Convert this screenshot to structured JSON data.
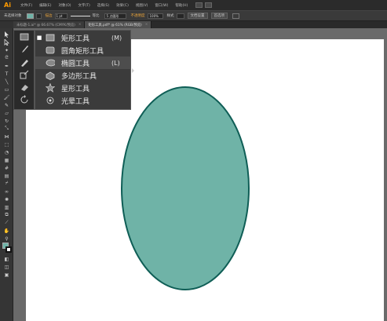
{
  "app": {
    "logo": "Ai",
    "accent": "#ff9a00"
  },
  "menubar": {
    "items": [
      "文件(F)",
      "编辑(E)",
      "对象(O)",
      "文字(T)",
      "选择(S)",
      "效果(C)",
      "视图(V)",
      "窗口(W)",
      "帮助(H)"
    ]
  },
  "controlbar": {
    "selection_label": "未选择对象",
    "fill_color": "#6fb3a7",
    "stroke_label": "描边",
    "stroke_width_value": "1 pt",
    "stroke_profile": "等比",
    "brush_value": "5 点圆形",
    "opacity_label": "不透明度",
    "opacity_value": "100%",
    "style_label": "样式",
    "doc_setup_button": "文档设置",
    "preferences_button": "首选项"
  },
  "tabs": [
    {
      "label": "未标题-1.ai* @ 66.67% (CMYK/预览)",
      "active": false,
      "close": "×"
    },
    {
      "label": "矩形工具.pdf* @ 61% (RGB/预览)",
      "active": true,
      "close": "×"
    }
  ],
  "flyout": {
    "items": [
      {
        "label": "矩形工具",
        "shortcut": "(M)",
        "icon": "rectangle-icon",
        "selected": true
      },
      {
        "label": "圆角矩形工具",
        "shortcut": "",
        "icon": "rounded-rectangle-icon",
        "selected": false
      },
      {
        "label": "椭圆工具",
        "shortcut": "(L)",
        "icon": "ellipse-icon",
        "selected": false
      },
      {
        "label": "多边形工具",
        "shortcut": "",
        "icon": "polygon-icon",
        "selected": false
      },
      {
        "label": "星形工具",
        "shortcut": "",
        "icon": "star-icon",
        "selected": false
      },
      {
        "label": "光晕工具",
        "shortcut": "",
        "icon": "flare-icon",
        "selected": false
      }
    ],
    "current_index": 2
  },
  "artwork": {
    "ellipse_fill": "#6fb3a7",
    "ellipse_stroke": "#0f5e56"
  }
}
